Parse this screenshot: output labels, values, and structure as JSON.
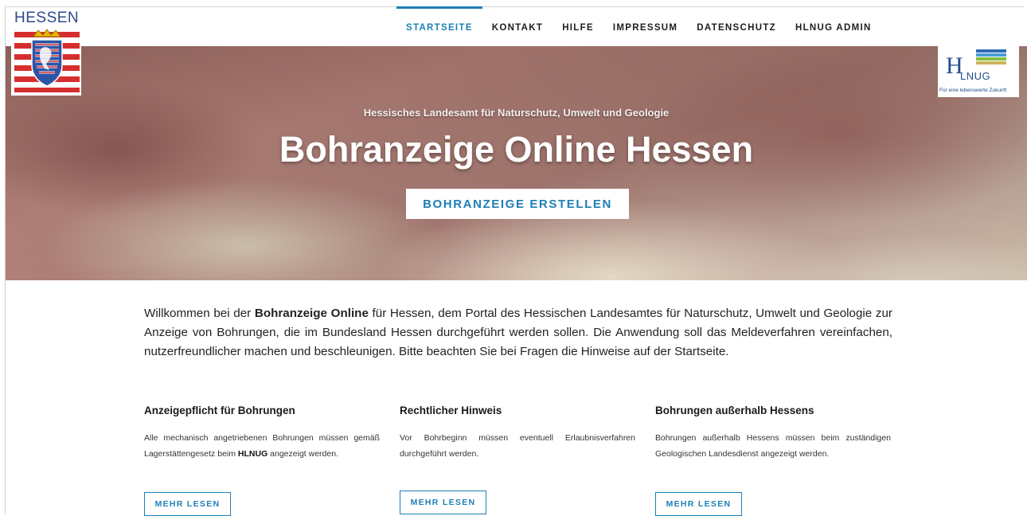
{
  "nav": {
    "items": [
      {
        "label": "STARTSEITE",
        "active": true
      },
      {
        "label": "KONTAKT"
      },
      {
        "label": "HILFE"
      },
      {
        "label": "IMPRESSUM"
      },
      {
        "label": "DATENSCHUTZ"
      },
      {
        "label": "HLNUG ADMIN"
      }
    ]
  },
  "logos": {
    "hessen": {
      "text": "HESSEN",
      "icon": "hessen-coat-of-arms-icon"
    },
    "hlnug": {
      "text_h": "H",
      "text_rest": "LNUG",
      "tagline": "Für eine lebenswerte Zukunft",
      "icon": "hlnug-logo-icon"
    }
  },
  "hero": {
    "subtitle": "Hessisches Landesamt für Naturschutz, Umwelt und Geologie",
    "title": "Bohranzeige Online Hessen",
    "cta": "BOHRANZEIGE ERSTELLEN"
  },
  "intro": {
    "before": "Willkommen bei der ",
    "bold": "Bohranzeige Online",
    "after": " für Hessen, dem Portal des Hessischen Landesamtes für Naturschutz, Umwelt und Geologie zur Anzeige von Bohrungen, die im Bundesland Hessen durchgeführt werden sollen. Die Anwendung soll das Meldeverfahren vereinfachen, nutzerfreundlicher machen und beschleunigen. Bitte beachten Sie bei Fragen die Hinweise auf der Startseite."
  },
  "columns": [
    {
      "title": "Anzeigepflicht für Bohrungen",
      "text_before": "Alle mechanisch angetriebenen Bohrungen müssen gemäß Lagerstättengesetz beim ",
      "text_bold": "HLNUG",
      "text_after": " angezeigt werden.",
      "button": "MEHR LESEN"
    },
    {
      "title": "Rechtlicher Hinweis",
      "text_before": "Vor Bohrbeginn müssen eventuell Erlaubnisverfahren durchgeführt werden.",
      "text_bold": "",
      "text_after": "",
      "button": "MEHR LESEN"
    },
    {
      "title": "Bohrungen außerhalb Hessens",
      "text_before": "Bohrungen außerhalb Hessens müssen beim zuständigen Geologischen Landesdienst angezeigt werden.",
      "text_bold": "",
      "text_after": "",
      "button": "MEHR LESEN"
    }
  ],
  "colors": {
    "accent": "#1d7fb5",
    "logo_blue": "#1f4e8c",
    "flag_red": "#d62e2e"
  }
}
